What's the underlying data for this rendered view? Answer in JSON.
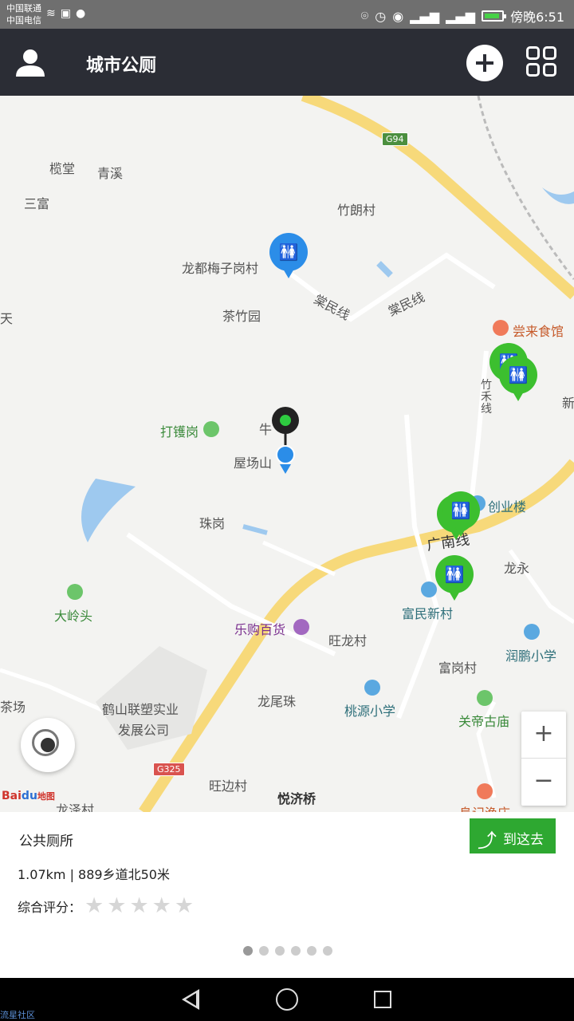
{
  "status_bar": {
    "carrier_1": "中国联通",
    "carrier_2": "中国电信",
    "time": "傍晚6:51"
  },
  "header": {
    "title": "城市公厕",
    "icons": [
      "user-icon",
      "add-icon",
      "grid-icon"
    ]
  },
  "map": {
    "places": {
      "gantang": "榄堂",
      "qingxi": "青溪",
      "sanfu": "三富",
      "zhulang": "竹朗村",
      "meizigang": "龙都梅子岗村",
      "tangmin_1": "棠民线",
      "tangmin_2": "棠民线",
      "chazhuyuan": "茶竹园",
      "tian": "天",
      "changlai": "尝来食馆",
      "zhuhe": "竹禾线",
      "xin": "新",
      "daxiang": "打镬岗",
      "niu": "牛",
      "wuchangshan": "屋场山",
      "chuangye": "创业楼",
      "zhugang": "珠岗",
      "guangnan": "广南线",
      "longyong": "龙永",
      "dalingtou": "大岭头",
      "fumin": "富民新村",
      "legou": "乐购百货",
      "wanglong": "旺龙村",
      "runpeng": "润鹏小学",
      "fugang": "富岗村",
      "heshan": "鹤山联塑实业",
      "fazhan": "发展公司",
      "longweizhu": "龙尾珠",
      "taoyuan": "桃源小学",
      "guandi": "关帝古庙",
      "chachang": "茶场",
      "wangbian": "旺边村",
      "yueji": "悦济桥",
      "longze": "龙泽村",
      "fuji": "阜记渔庄"
    },
    "highway_labels": {
      "g94": "G94",
      "g325": "G325"
    },
    "baidu_logo": {
      "bai": "Bai",
      "du": "du",
      "ditu": "地图"
    }
  },
  "info_panel": {
    "title": "公共厕所",
    "go_button": "到这去",
    "distance": "1.07km | 889乡道北50米",
    "rating_label": "综合评分：",
    "rating": 0,
    "rating_max": 5,
    "pages": 6,
    "active_page": 1
  },
  "watermark": "流星社区",
  "colors": {
    "header_bg": "#2b2d35",
    "toilet_pin": "#3cbf2f",
    "go_button": "#2ea831",
    "road_main": "#f7d97a"
  }
}
